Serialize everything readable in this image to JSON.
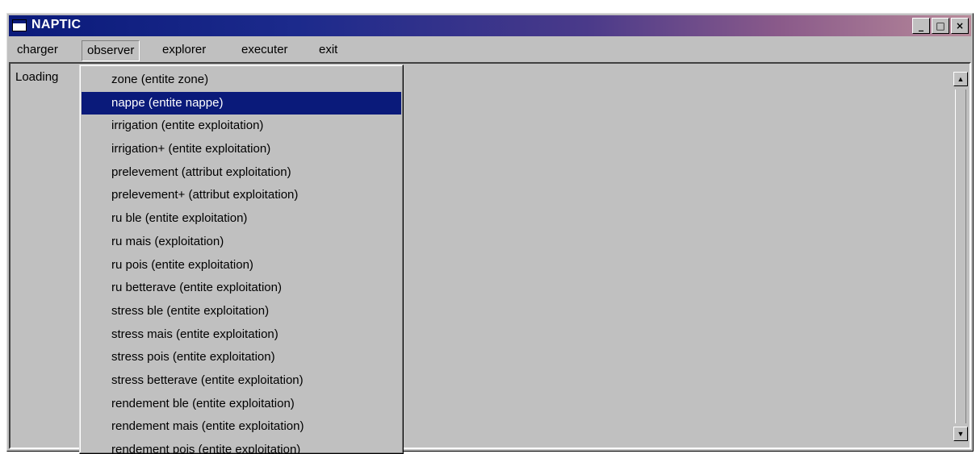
{
  "window": {
    "title": "NAPTIC",
    "controls": {
      "minimize": "_",
      "maximize": "□",
      "close": "×"
    }
  },
  "menubar": {
    "items": [
      {
        "label": "charger"
      },
      {
        "label": "observer"
      },
      {
        "label": "explorer"
      },
      {
        "label": "executer"
      },
      {
        "label": "exit"
      }
    ],
    "open_index": 1
  },
  "client": {
    "status_text": "Loading"
  },
  "scrollbar": {
    "up_icon": "▲",
    "down_icon": "▼"
  },
  "dropdown": {
    "selected_index": 1,
    "items": [
      {
        "label": "zone (entite zone)"
      },
      {
        "label": "nappe (entite nappe)"
      },
      {
        "label": "irrigation (entite exploitation)"
      },
      {
        "label": "irrigation+ (entite exploitation)"
      },
      {
        "label": "prelevement (attribut exploitation)"
      },
      {
        "label": "prelevement+ (attribut exploitation)"
      },
      {
        "label": "ru ble (entite exploitation)"
      },
      {
        "label": "ru mais (exploitation)"
      },
      {
        "label": "ru pois (entite exploitation)"
      },
      {
        "label": "ru betterave (entite exploitation)"
      },
      {
        "label": "stress ble (entite exploitation)"
      },
      {
        "label": "stress mais (entite exploitation)"
      },
      {
        "label": "stress pois (entite exploitation)"
      },
      {
        "label": "stress betterave (entite exploitation)"
      },
      {
        "label": "rendement ble (entite exploitation)"
      },
      {
        "label": "rendement mais (entite exploitation)"
      },
      {
        "label": "rendement pois (entite exploitation)"
      }
    ]
  },
  "colors": {
    "selection": "#0a1a7a",
    "window_face": "#c0c0c0"
  }
}
